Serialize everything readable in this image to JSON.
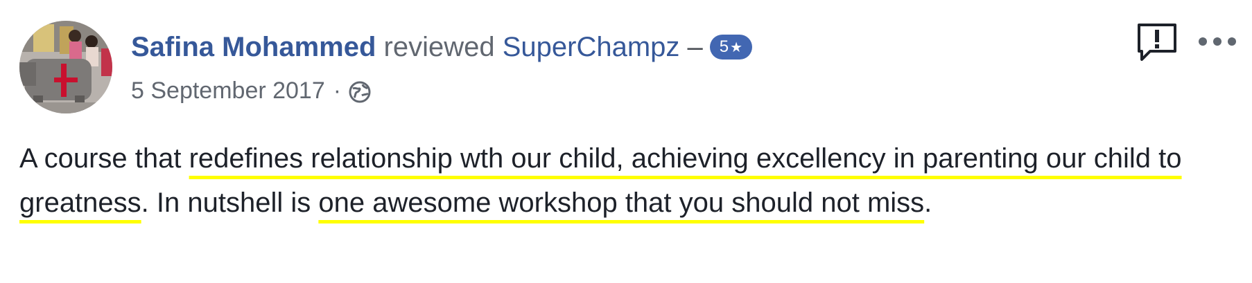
{
  "review": {
    "reviewer_name": "Safina Mohammed",
    "action_text": "reviewed",
    "page_name": "SuperChampz",
    "separator": "–",
    "rating": "5",
    "date": "5 September 2017",
    "meta_separator": "·",
    "privacy_icon": "globe-icon",
    "text_segments": [
      "A course that ",
      "redefines relationship wth our child, achieving excellency in parenting our child to greatness",
      ". In nutshell is ",
      "one awesome workshop that you should not miss",
      "."
    ]
  },
  "actions": {
    "report_icon": "report-icon",
    "more_icon": "more-options-icon"
  },
  "colors": {
    "link": "#365899",
    "badge": "#4267b2",
    "highlight_underline": "#ffff00",
    "body_text": "#1d2129",
    "meta_text": "#616770"
  }
}
